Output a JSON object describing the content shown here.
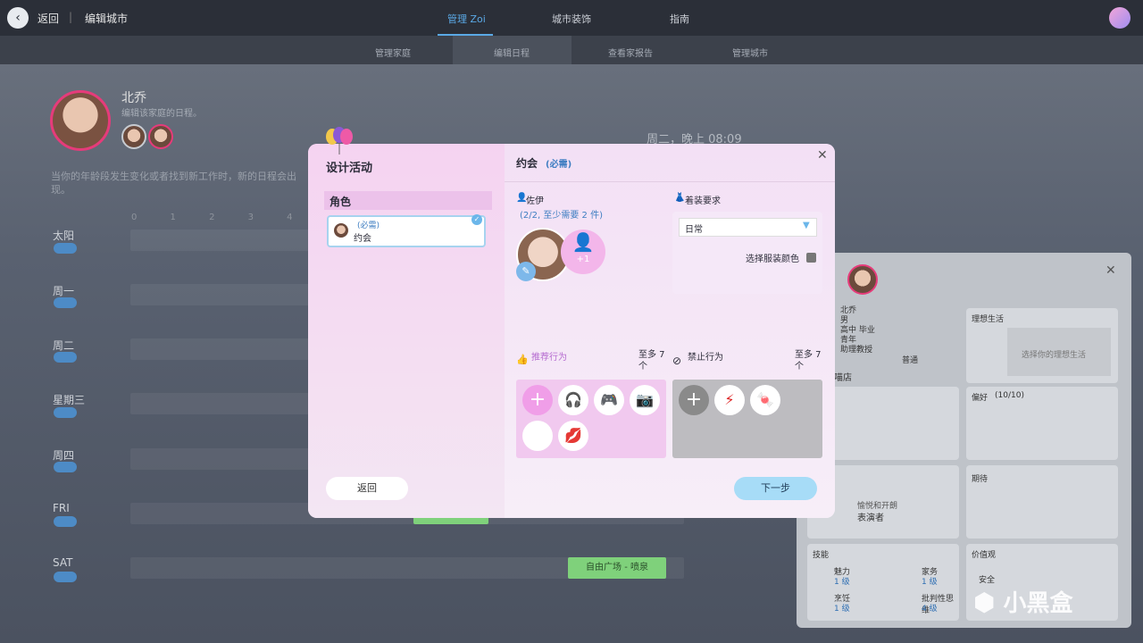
{
  "topbar": {
    "back_label": "返回",
    "divider": "|",
    "edit_city": "编辑城市",
    "tabs": [
      "管理 Zoi",
      "城市装饰",
      "指南"
    ]
  },
  "subtabs": [
    "管理家庭",
    "编辑日程",
    "查看家报告",
    "管理城市"
  ],
  "household": {
    "name": "北乔",
    "subtitle": "编辑该家庭的日程。",
    "info": "当你的年龄段发生变化或者找到新工作时，新的日程会出现。",
    "time": "周二，晚上 08:09",
    "hour_numbers": "0 1 2 3 4 5 6",
    "days": [
      "太阳",
      "周一",
      "周二",
      "星期三",
      "周四",
      "FRI",
      "SAT"
    ],
    "event_label": "自由广场 - 喷泉"
  },
  "modal": {
    "title": "设计活动",
    "role_header": "角色",
    "role_item": {
      "required": "(必需)",
      "label": "约会"
    },
    "back_button": "返回",
    "activity_title": "约会",
    "activity_required": "(必需)",
    "character_name": "佐伊",
    "character_count": "(2/2, 至少需要 2 件)",
    "plus_one": "+1",
    "dress_label": "着装要求",
    "dress_value": "日常",
    "choose_color": "选择服装颜色",
    "recommended_label": "推荐行为",
    "recommended_max": "至多 7 个",
    "forbidden_label": "禁止行为",
    "forbidden_max": "至多 7 个",
    "next_button": "下一步",
    "recommended_icons": [
      "headphones-icon",
      "gamepad-icon",
      "camera-icon",
      "heart-icon",
      "lips-icon"
    ],
    "forbidden_icons": [
      "lightning-icon",
      "candy-icon"
    ]
  },
  "right_panel": {
    "name": "北乔",
    "gender": "男",
    "edu": "高中 毕业",
    "age": "青年",
    "job": "助理教授",
    "status": "普通",
    "shop": "喵店",
    "ideal_life": "理想生活",
    "ideal_hint": "选择你的理想生活",
    "preferences": "偏好",
    "preferences_count": "(10/10)",
    "expectation": "期待",
    "performer_sub": "愉悦和开朗",
    "performer": "表演者",
    "skills": "技能",
    "values": "价值观",
    "safety": "安全",
    "skill_rows": [
      {
        "name": "魅力",
        "level": "1 级"
      },
      {
        "name": "家务",
        "level": "1 级"
      },
      {
        "name": "烹饪",
        "level": "1 级"
      },
      {
        "name": "批判性思维",
        "level": "4 级"
      }
    ]
  },
  "watermark": "小黑盒"
}
